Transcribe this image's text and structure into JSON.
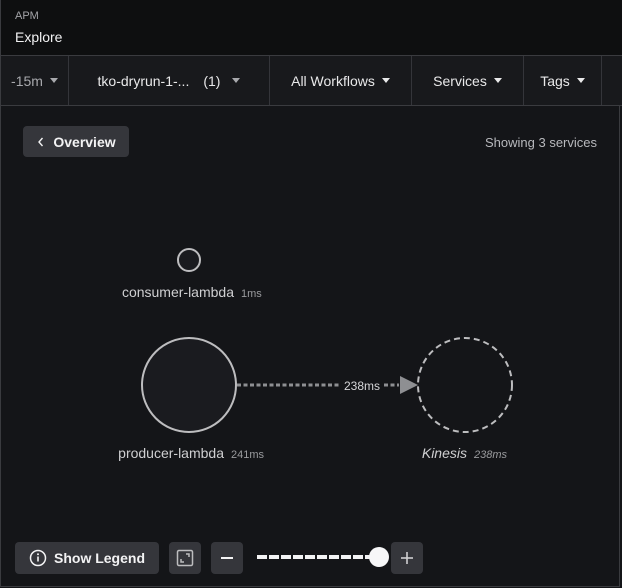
{
  "header": {
    "section": "APM",
    "title": "Explore"
  },
  "filters": [
    {
      "label": "-15m",
      "muted": true
    },
    {
      "label": "tko-dryrun-1-...",
      "count": "(1)",
      "muted": false
    },
    {
      "label": "All Workflows",
      "muted": false
    },
    {
      "label": "Services",
      "muted": false
    },
    {
      "label": "Tags",
      "muted": false
    }
  ],
  "overview_button": {
    "icon": "chevron-left-icon",
    "label": "Overview"
  },
  "showing_text": "Showing 3 services",
  "graph": {
    "nodes": [
      {
        "name": "consumer-lambda",
        "latency": "1ms",
        "style": "solid",
        "inferred": false
      },
      {
        "name": "producer-lambda",
        "latency": "241ms",
        "style": "solid",
        "inferred": false
      },
      {
        "name": "Kinesis",
        "latency": "238ms",
        "style": "dashed",
        "inferred": true
      }
    ],
    "edges": [
      {
        "from": "producer-lambda",
        "to": "Kinesis",
        "label": "238ms",
        "style": "dotted"
      }
    ]
  },
  "controls": {
    "legend_button": {
      "icon": "info-icon",
      "label": "Show Legend"
    },
    "fit_icon": "fit-to-screen-icon",
    "zoom_out_icon": "minus-icon",
    "zoom_in_icon": "plus-icon",
    "zoom_level_fraction": 1.0
  },
  "colors": {
    "background": "#141518",
    "header": "#0e0f10",
    "button": "#35363b",
    "node_stroke": "#bdbdbf",
    "edge": "#8e8f92"
  }
}
